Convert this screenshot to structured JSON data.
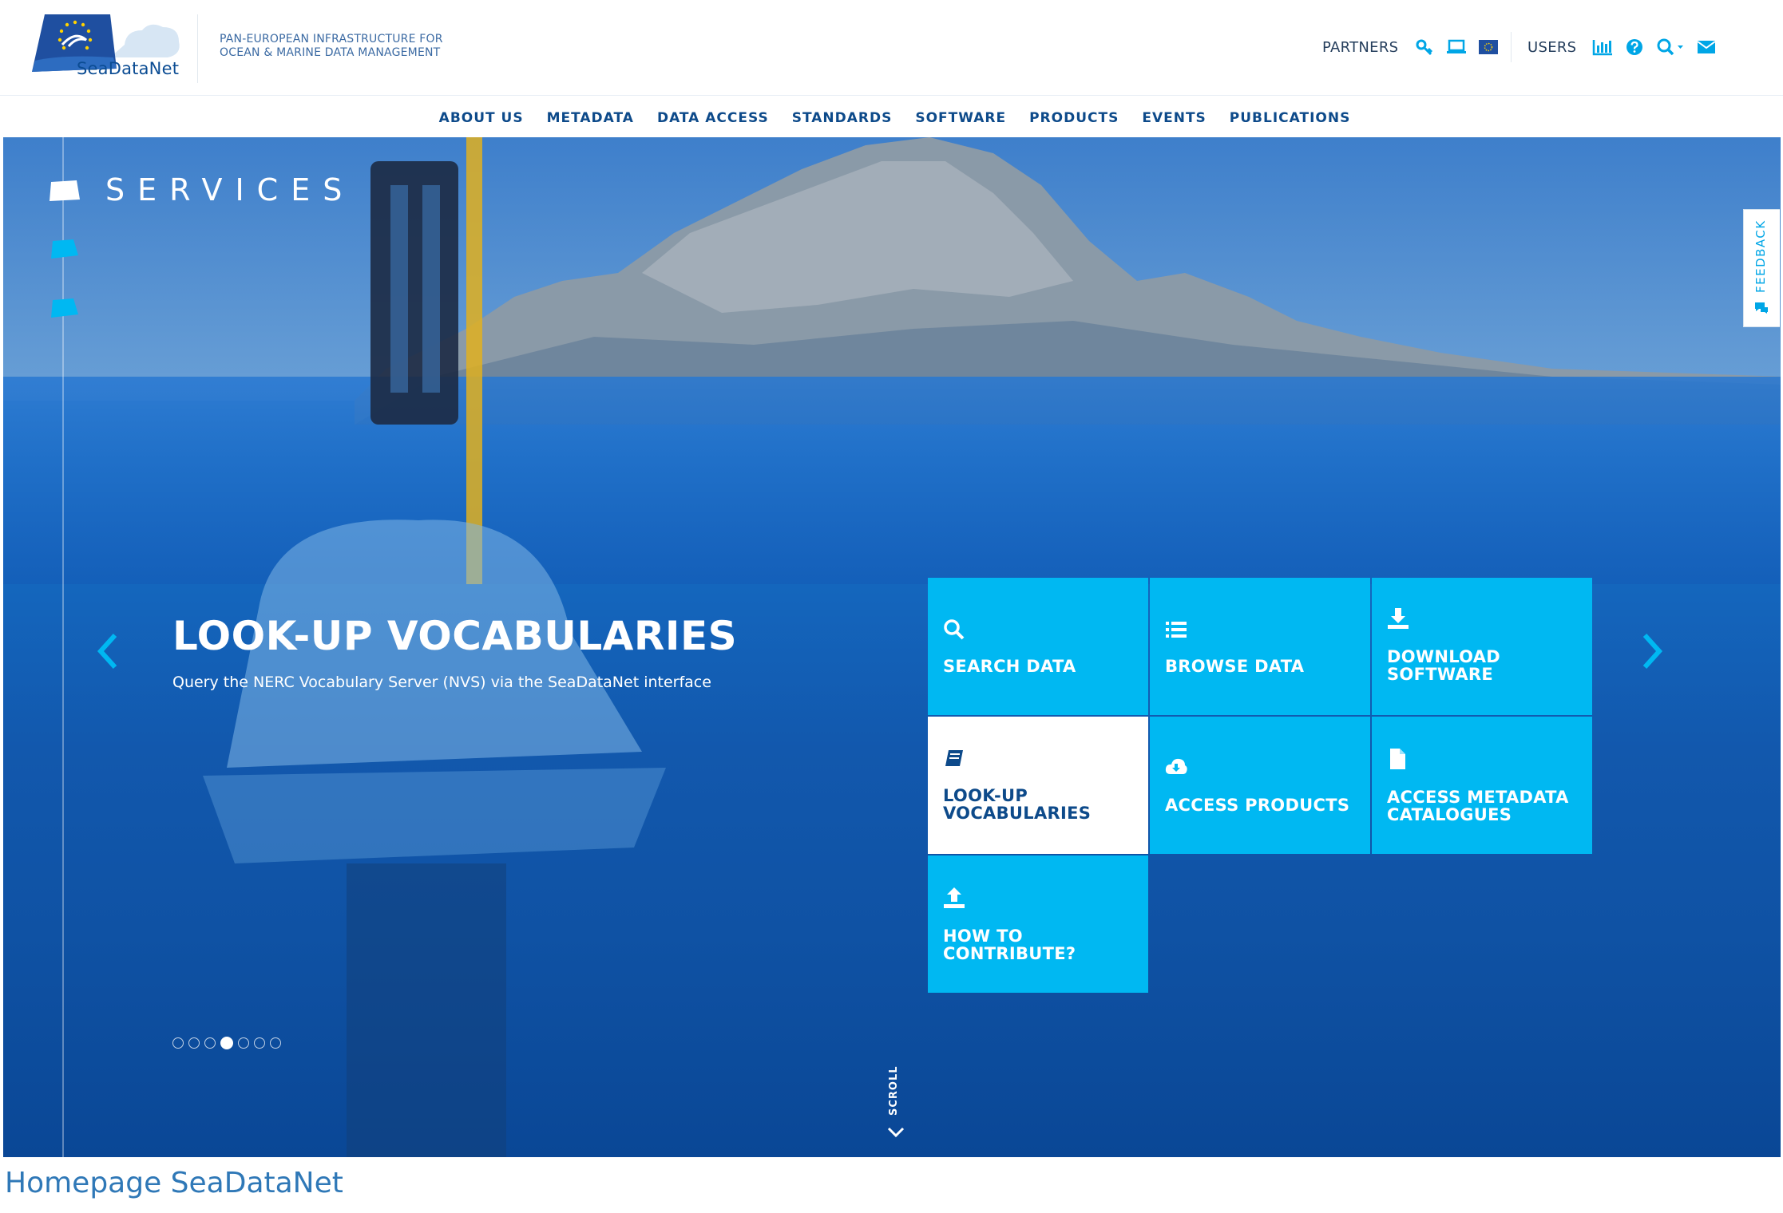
{
  "header": {
    "logo_text": "SeaDataNet",
    "tagline_line1": "PAN-EUROPEAN INFRASTRUCTURE FOR",
    "tagline_line2": "OCEAN & MARINE DATA MANAGEMENT",
    "partners_label": "PARTNERS",
    "users_label": "USERS",
    "partner_icons": [
      "key-icon",
      "laptop-icon",
      "eu-flag-icon"
    ],
    "user_icons": [
      "bar-chart-icon",
      "help-icon",
      "search-icon",
      "envelope-icon"
    ]
  },
  "nav": {
    "items": [
      "ABOUT US",
      "METADATA",
      "DATA ACCESS",
      "STANDARDS",
      "SOFTWARE",
      "PRODUCTS",
      "EVENTS",
      "PUBLICATIONS"
    ]
  },
  "hero": {
    "section_label": "SERVICES",
    "slide_title": "LOOK-UP VOCABULARIES",
    "slide_subtitle": "Query the NERC Vocabulary Server (NVS) via the SeaDataNet interface",
    "slide_count": 7,
    "active_slide": 4,
    "scroll_label": "SCROLL"
  },
  "tiles": [
    {
      "line1": "SEARCH DATA",
      "line2": "",
      "icon": "search-icon"
    },
    {
      "line1": "BROWSE DATA",
      "line2": "",
      "icon": "list-icon"
    },
    {
      "line1": "DOWNLOAD",
      "line2": "SOFTWARE",
      "icon": "download-icon"
    },
    {
      "line1": "LOOK-UP",
      "line2": "VOCABULARIES",
      "icon": "book-icon"
    },
    {
      "line1": "ACCESS PRODUCTS",
      "line2": "",
      "icon": "cloud-download-icon"
    },
    {
      "line1": "ACCESS METADATA",
      "line2": "CATALOGUES",
      "icon": "file-icon"
    },
    {
      "line1": "HOW TO",
      "line2": "CONTRIBUTE?",
      "icon": "upload-icon"
    }
  ],
  "feedback_label": "FEEDBACK",
  "caption": "Homepage SeaDataNet",
  "colors": {
    "brand_blue": "#0b4c93",
    "tile_cyan": "#00b8f2",
    "accent_cyan": "#00a6e6"
  }
}
